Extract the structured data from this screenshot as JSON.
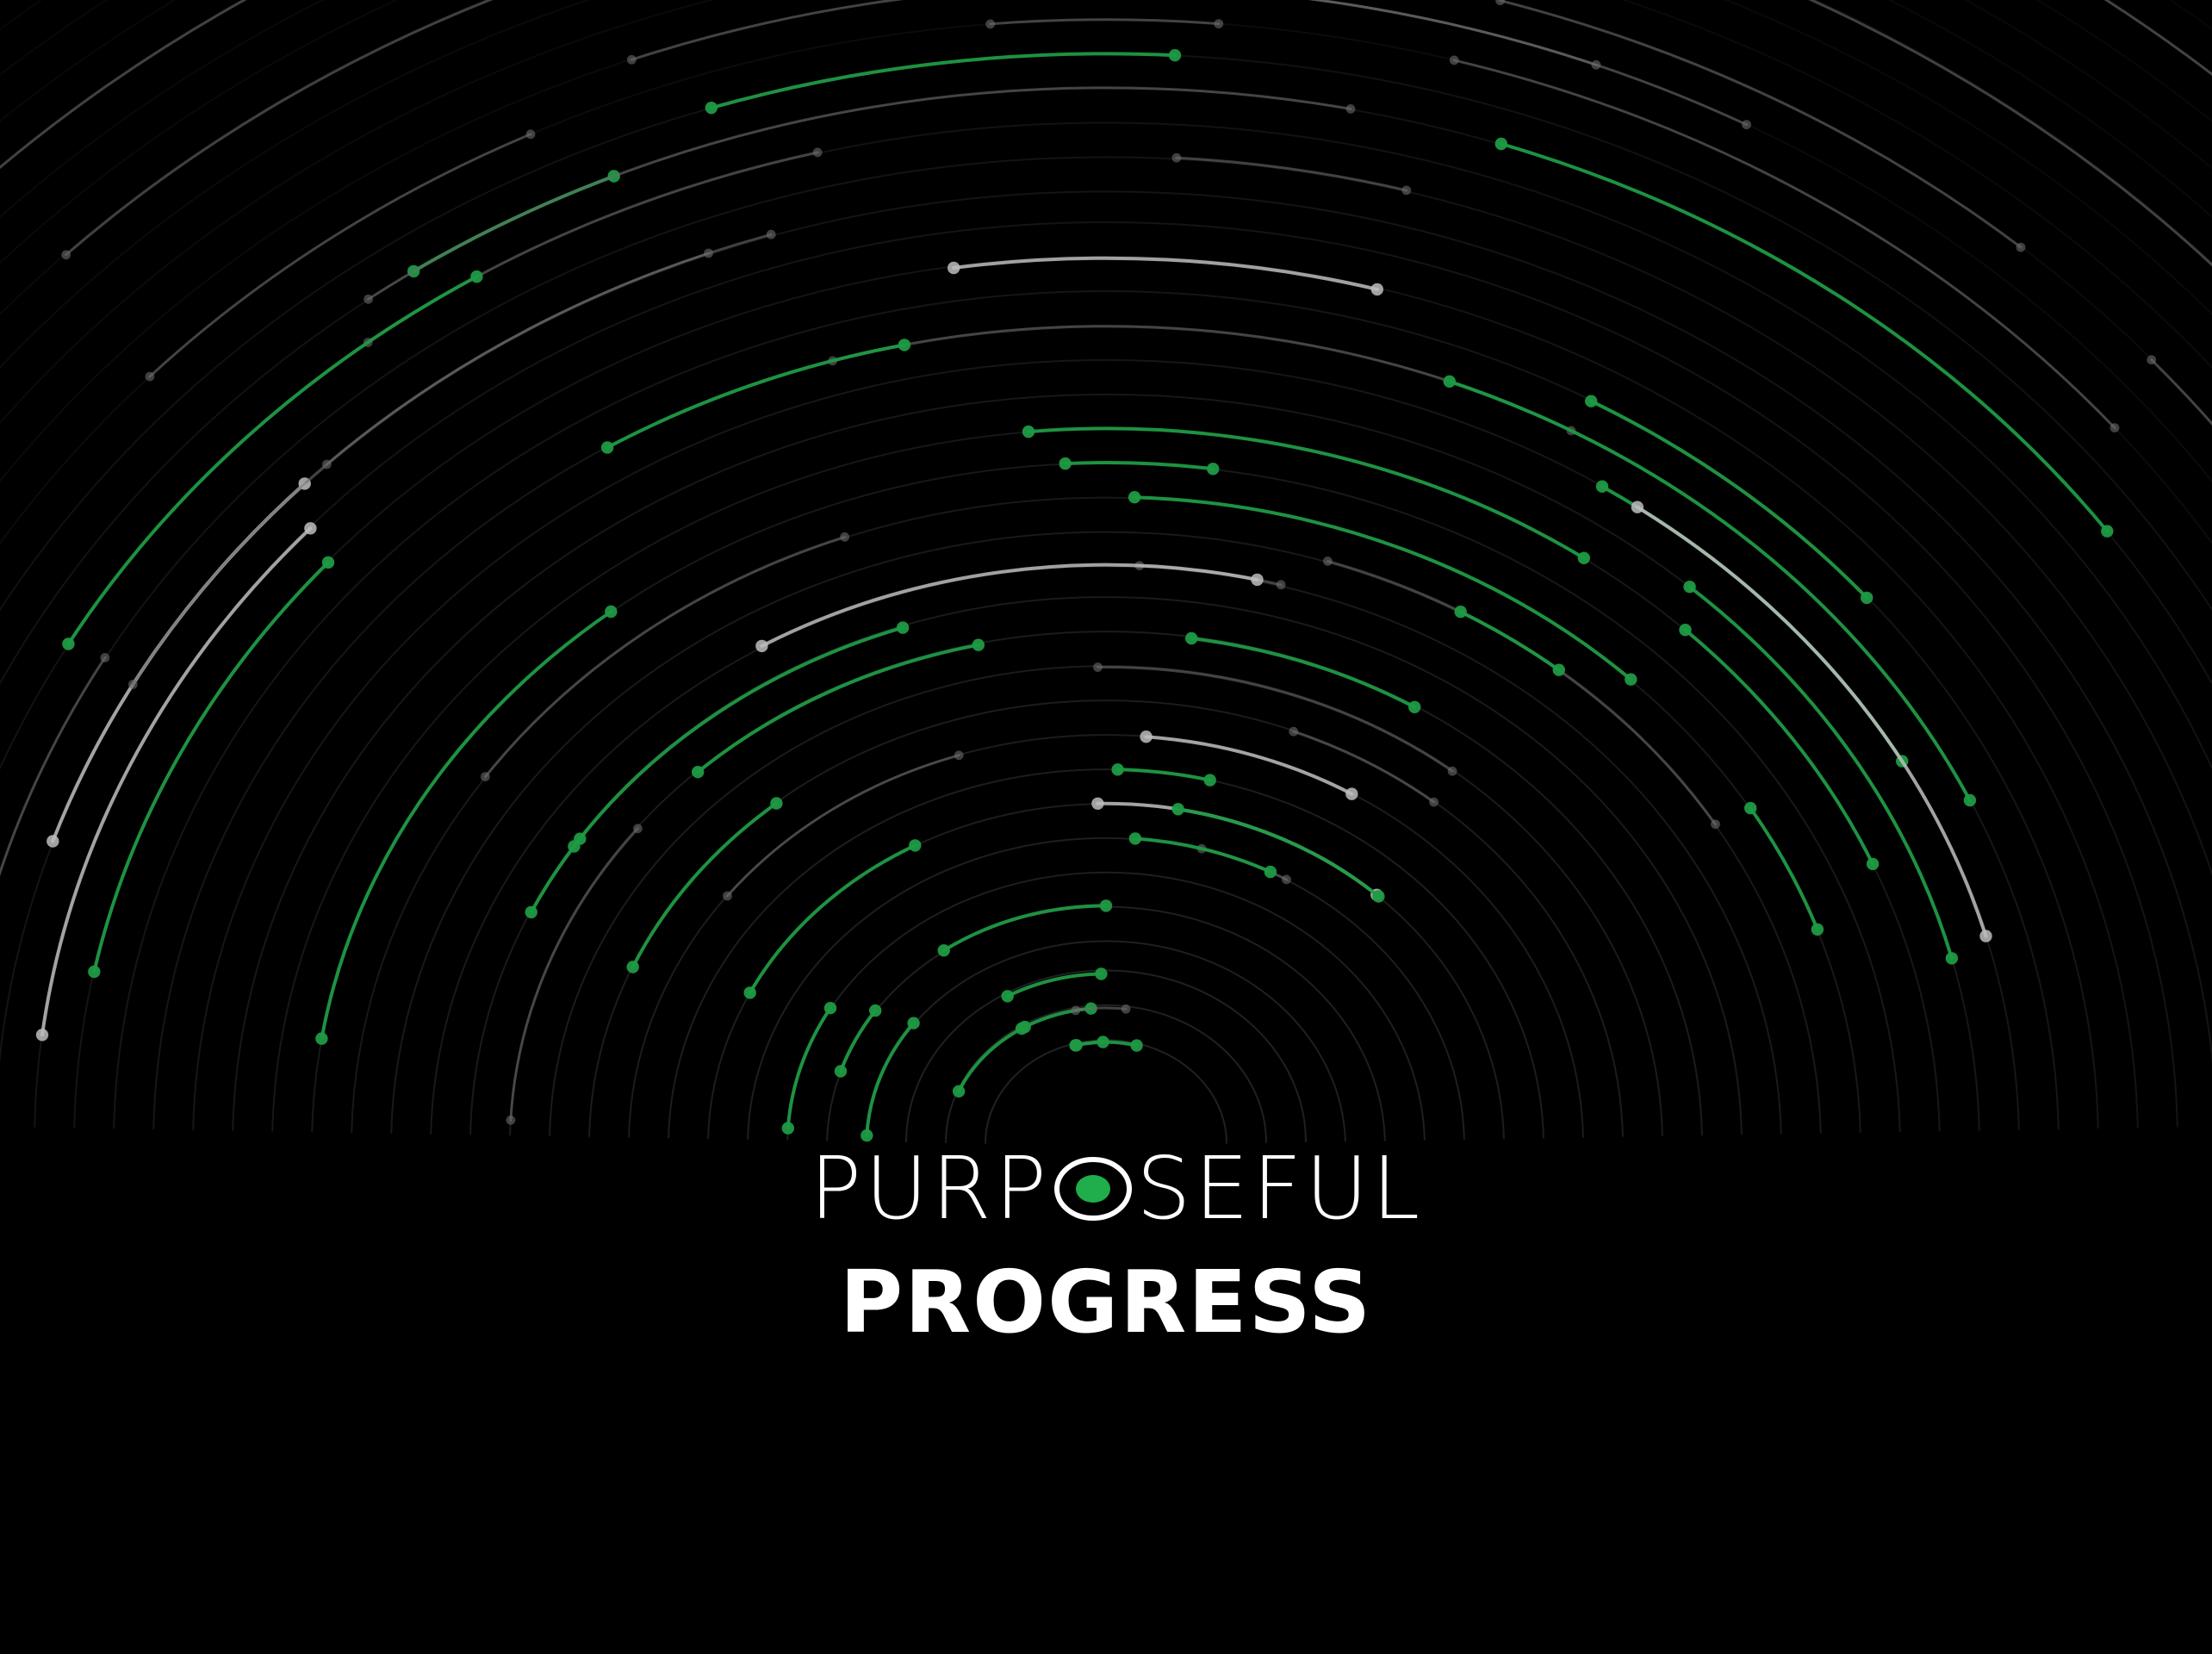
{
  "title": {
    "word1_before": "PURP",
    "word1_after": "SEFUL",
    "word2": "PROGRESS"
  },
  "colors": {
    "background": "#000000",
    "accent_green": "#1f9a44",
    "ring_gray": "#5a5a5a",
    "ring_light": "#bdbdbd",
    "text": "#ffffff"
  },
  "icons": {
    "o_mark": "eye-icon"
  }
}
